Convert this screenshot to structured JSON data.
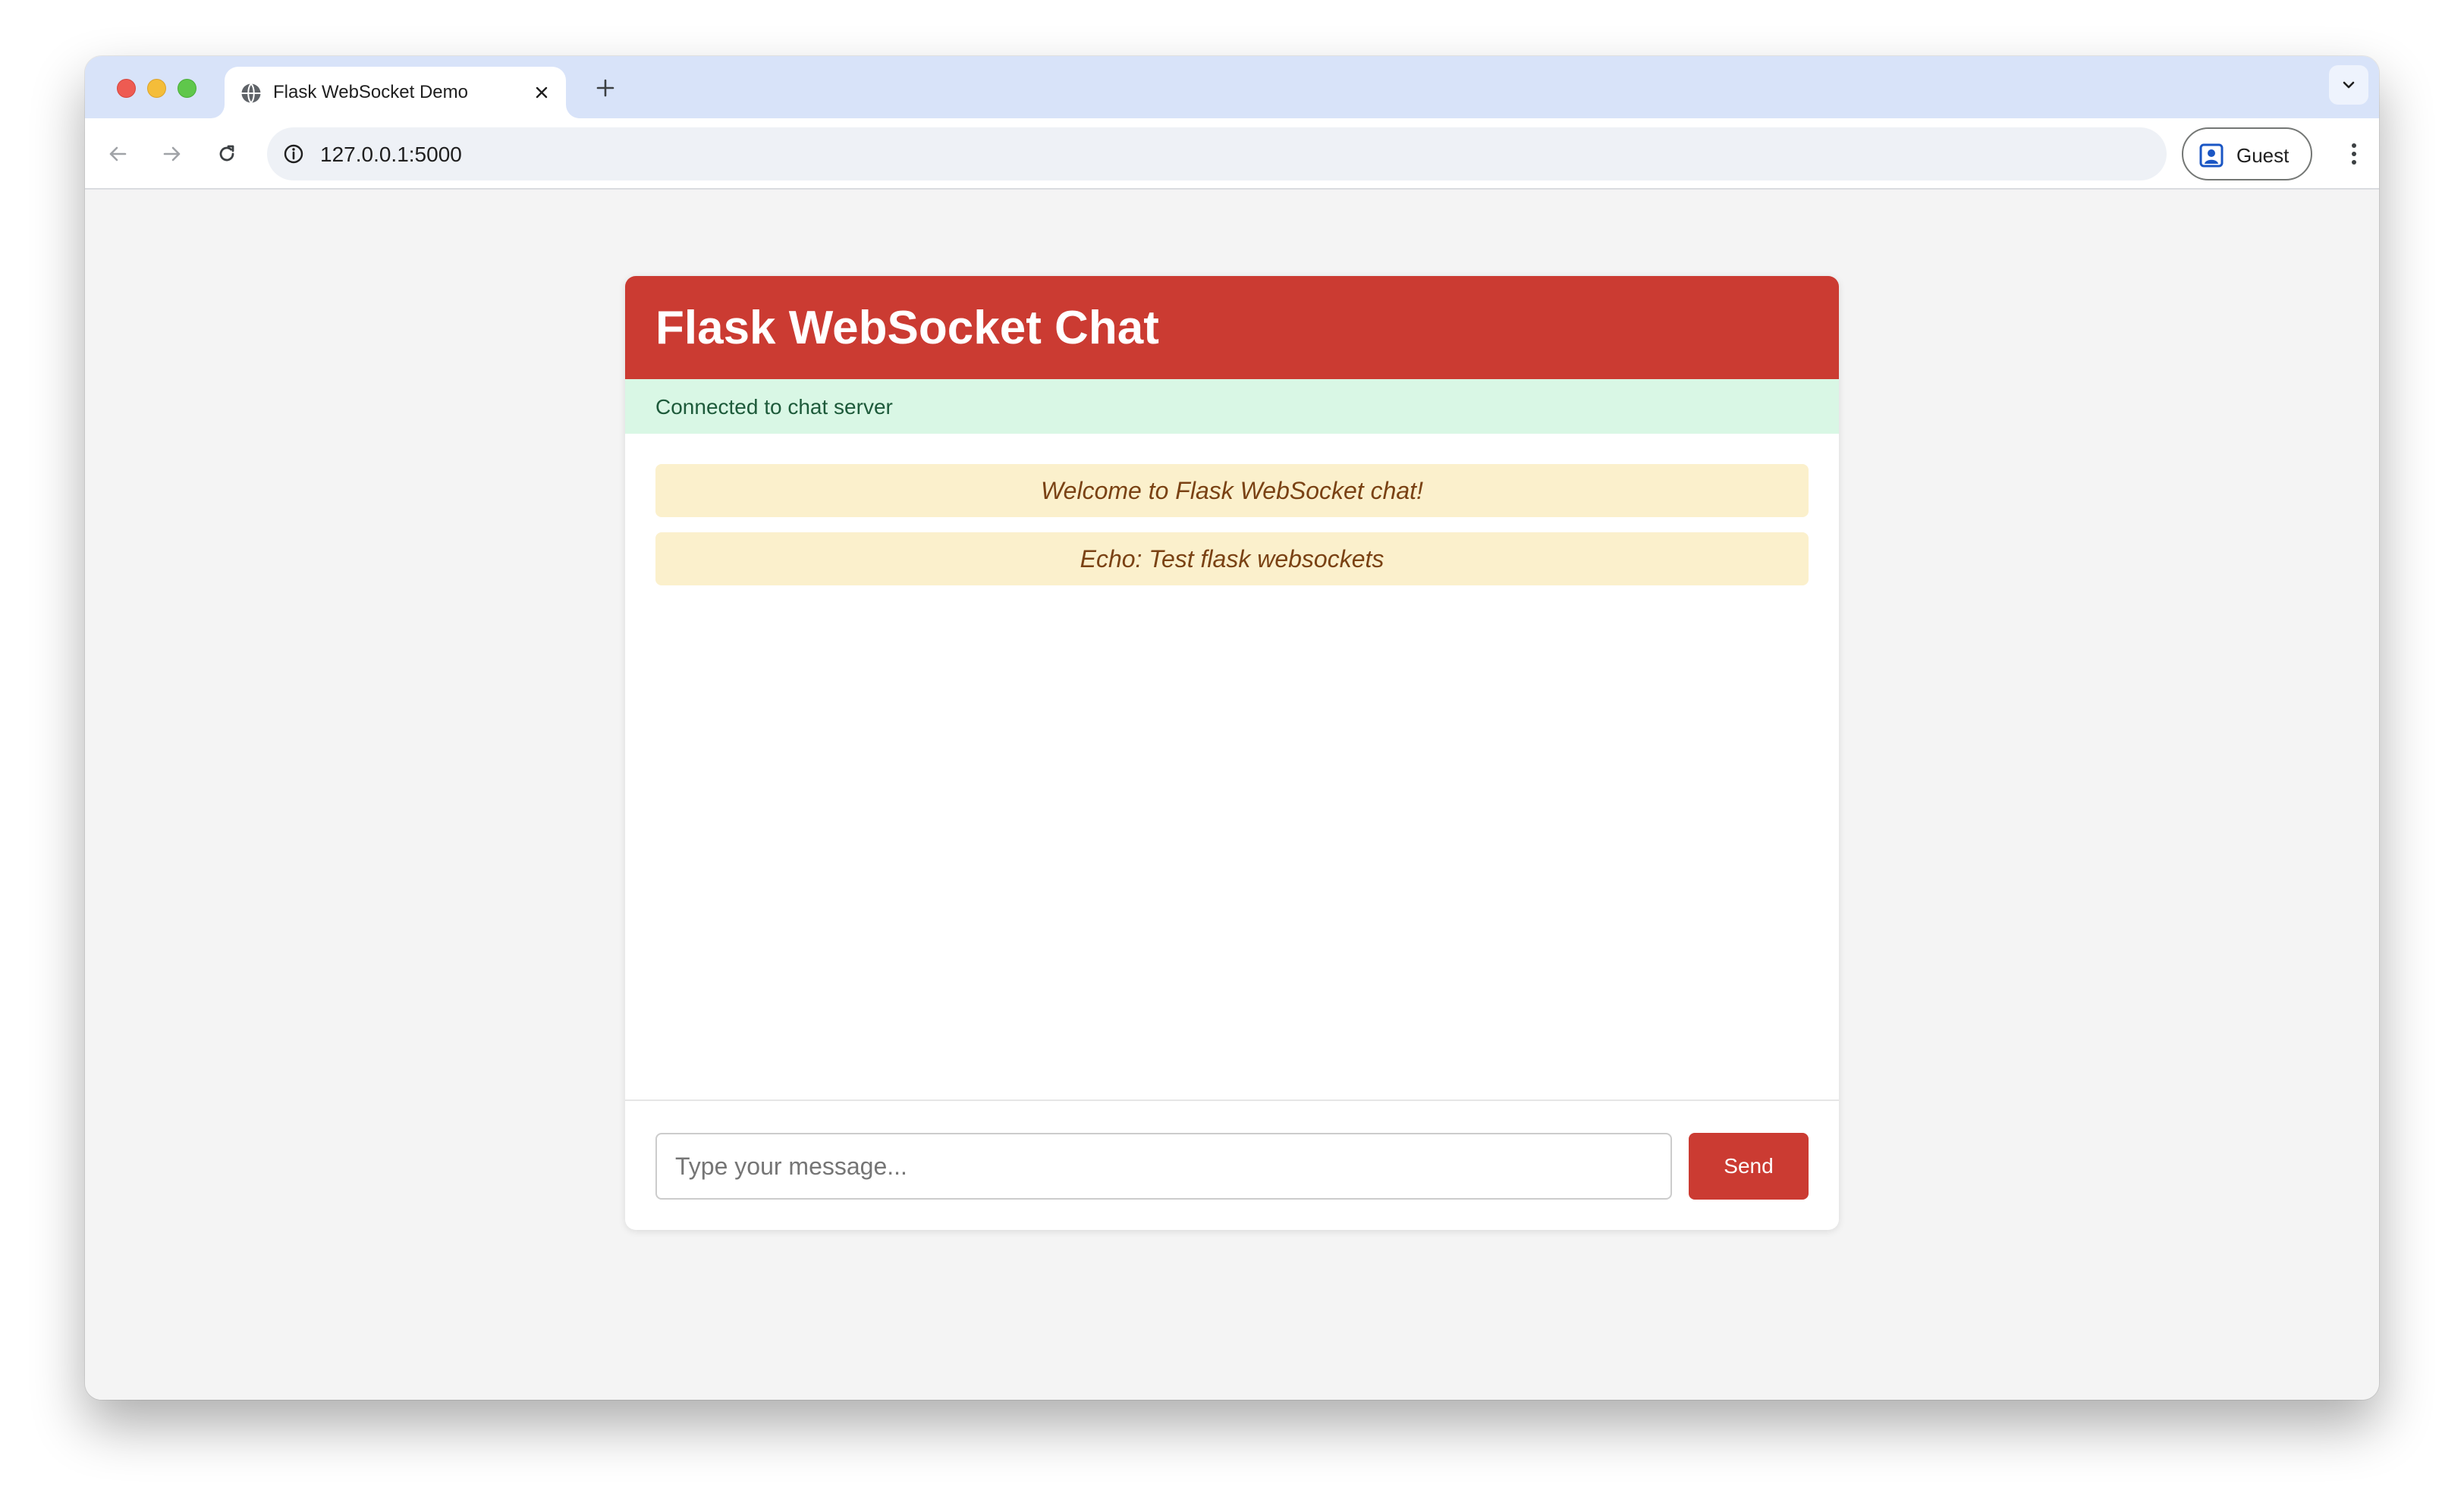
{
  "browser": {
    "tab": {
      "title": "Flask WebSocket Demo",
      "favicon": "globe-icon"
    },
    "address_bar": {
      "url": "127.0.0.1:5000"
    },
    "profile": {
      "label": "Guest"
    },
    "colors": {
      "tabstrip": "#d8e3f9",
      "omnibox": "#eef1f6"
    }
  },
  "chat": {
    "title": "Flask WebSocket Chat",
    "status": "Connected to chat server",
    "messages": [
      "Welcome to Flask WebSocket chat!",
      "Echo: Test flask websockets"
    ],
    "input": {
      "placeholder": "Type your message...",
      "value": ""
    },
    "send_label": "Send",
    "colors": {
      "header": "#cb3b32",
      "status_bg": "#d9f7e5",
      "message_bg": "#fbf0cc",
      "message_text": "#7a4214",
      "send_button": "#cb3b32"
    }
  }
}
